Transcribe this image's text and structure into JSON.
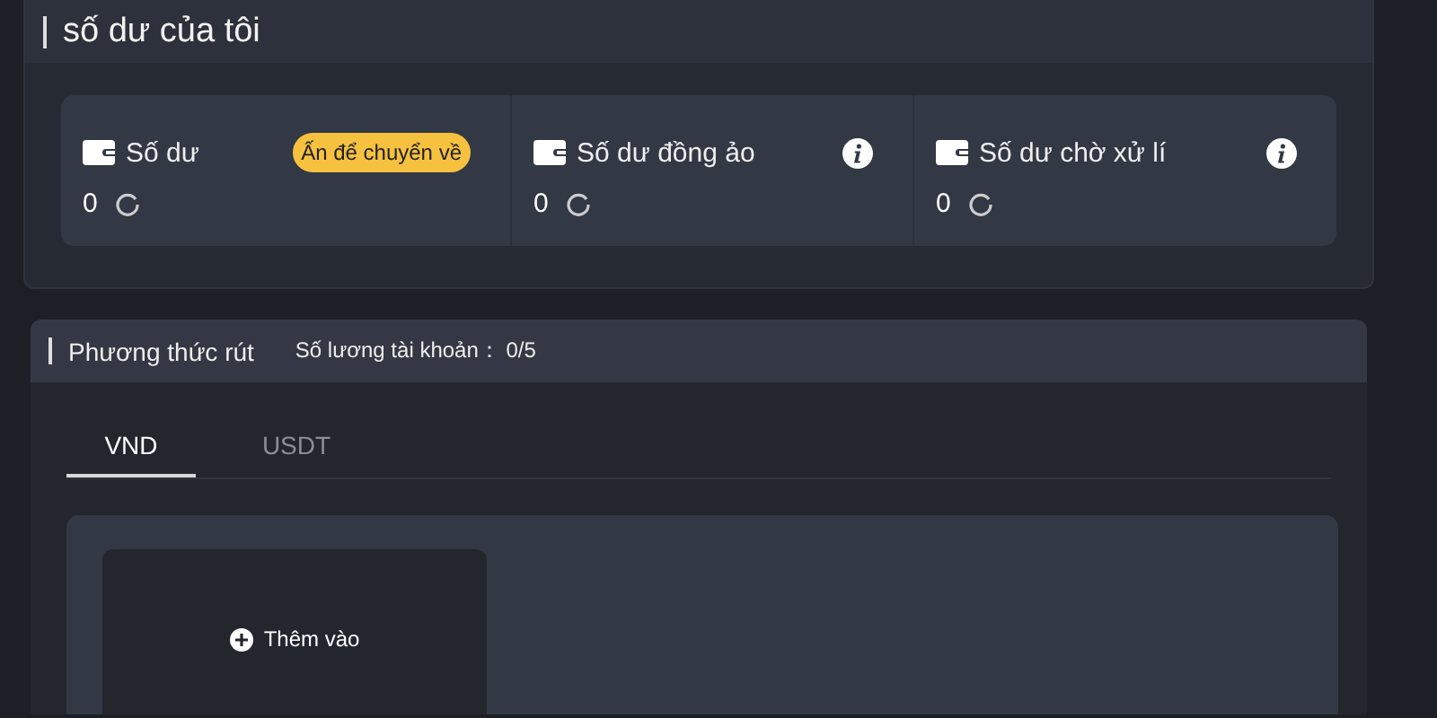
{
  "balance_card": {
    "title": "số dư của tôi",
    "balances": [
      {
        "label": "Số dư",
        "amount": "0",
        "action": "Ấn để chuyển về",
        "info": false
      },
      {
        "label": "Số dư đồng ảo",
        "amount": "0",
        "info": true
      },
      {
        "label": "Số dư chờ xử lí",
        "amount": "0",
        "info": true
      }
    ]
  },
  "withdraw_card": {
    "title": "Phương thức rút",
    "account_count": "Số lương tài khoản： 0/5",
    "tabs": [
      {
        "label": "VND",
        "selected": true
      },
      {
        "label": "USDT",
        "selected": false
      }
    ],
    "add_button": "Thêm vào"
  }
}
